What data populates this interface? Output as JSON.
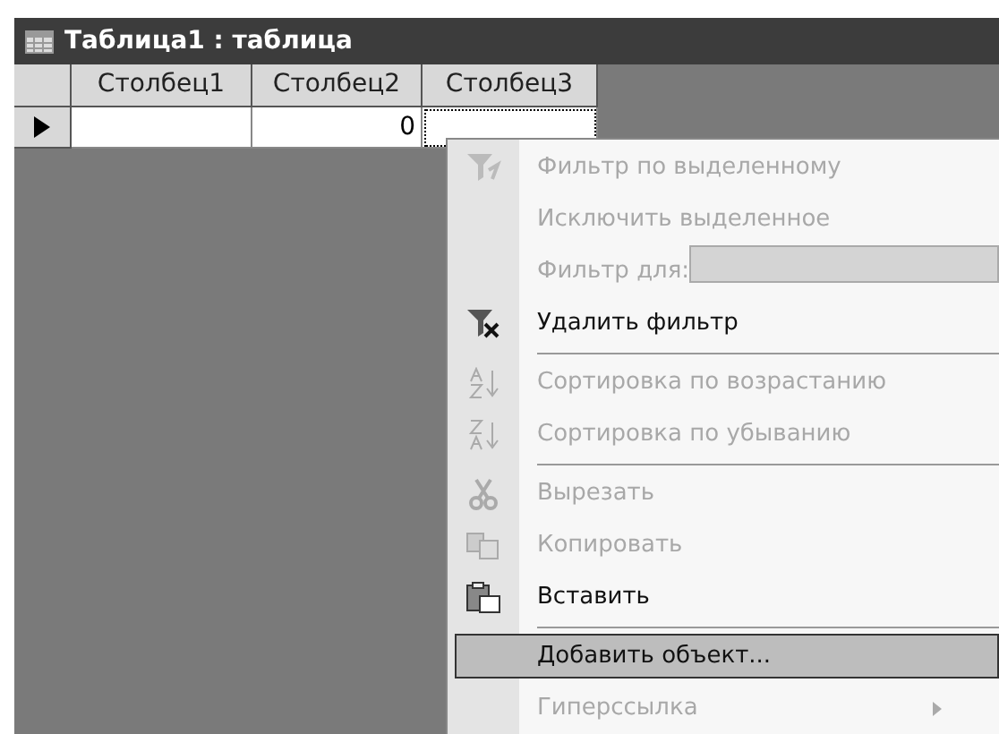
{
  "window": {
    "title": "Таблица1 : таблица"
  },
  "table": {
    "columns": [
      "Столбец1",
      "Столбец2",
      "Столбец3"
    ],
    "rows": [
      {
        "current": true,
        "cells": [
          "",
          "0",
          ""
        ]
      }
    ]
  },
  "context_menu": {
    "items": [
      {
        "kind": "item",
        "label": "Фильтр по выделенному",
        "disabled": true,
        "selected": false
      },
      {
        "kind": "item",
        "label": "Исключить выделенное",
        "disabled": true,
        "selected": false
      },
      {
        "kind": "field",
        "label": "Фильтр для:",
        "disabled": true,
        "selected": false
      },
      {
        "kind": "item",
        "label": "Удалить фильтр",
        "disabled": false,
        "selected": false
      },
      {
        "kind": "separator"
      },
      {
        "kind": "item",
        "label": "Сортировка по возрастанию",
        "disabled": true,
        "selected": false
      },
      {
        "kind": "item",
        "label": "Сортировка по убыванию",
        "disabled": true,
        "selected": false
      },
      {
        "kind": "separator"
      },
      {
        "kind": "item",
        "label": "Вырезать",
        "disabled": true,
        "selected": false
      },
      {
        "kind": "item",
        "label": "Копировать",
        "disabled": true,
        "selected": false
      },
      {
        "kind": "item",
        "label": "Вставить",
        "disabled": false,
        "selected": false
      },
      {
        "kind": "separator"
      },
      {
        "kind": "item",
        "label": "Добавить объект...",
        "disabled": false,
        "selected": true
      },
      {
        "kind": "submenu",
        "label": "Гиперссылка",
        "disabled": true,
        "selected": false
      }
    ]
  }
}
